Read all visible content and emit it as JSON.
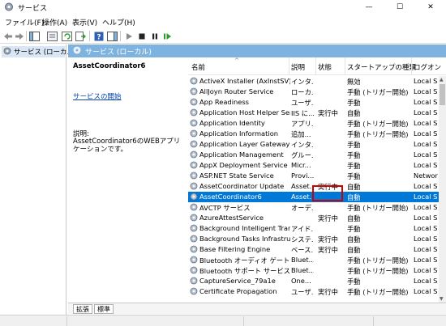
{
  "window": {
    "title": "サービス",
    "minimize_glyph": "—",
    "maximize_glyph": "☐",
    "close_glyph": "✕"
  },
  "menu": {
    "items": [
      "ファイル(F)",
      "操作(A)",
      "表示(V)",
      "ヘルプ(H)"
    ]
  },
  "toolbar": {
    "icons": [
      "back-icon",
      "forward-icon",
      "show-console-tree-icon",
      "properties-icon",
      "refresh-icon",
      "export-list-icon",
      "help-icon",
      "show-action-pane-icon",
      "play-icon",
      "stop-icon",
      "pause-icon",
      "restart-icon"
    ]
  },
  "tree": {
    "root_label": "サービス (ローカル)"
  },
  "pane": {
    "header": "サービス (ローカル)"
  },
  "detail": {
    "service_name": "AssetCoordinator6",
    "start_link": "サービスの開始",
    "description_label": "説明:",
    "description_text": "AssetCoordinator6のWEBアプリケーションです。"
  },
  "list": {
    "columns": {
      "name": "名前",
      "description": "説明",
      "status": "状態",
      "startup": "スタートアップの種類",
      "logon": "ログオン"
    },
    "rows": [
      {
        "name": "ActiveX Installer (AxInstSV)",
        "description": "インタ...",
        "status": "",
        "startup": "無効",
        "logon": "Local S"
      },
      {
        "name": "AllJoyn Router Service",
        "description": "ローカ...",
        "status": "",
        "startup": "手動 (トリガー開始)",
        "logon": "Local S"
      },
      {
        "name": "App Readiness",
        "description": "ユーザ...",
        "status": "",
        "startup": "手動",
        "logon": "Local S"
      },
      {
        "name": "Application Host Helper Ser...",
        "description": "IIS に...",
        "status": "実行中",
        "startup": "自動",
        "logon": "Local S"
      },
      {
        "name": "Application Identity",
        "description": "アプリ...",
        "status": "",
        "startup": "手動 (トリガー開始)",
        "logon": "Local S"
      },
      {
        "name": "Application Information",
        "description": "追加...",
        "status": "",
        "startup": "手動 (トリガー開始)",
        "logon": "Local S"
      },
      {
        "name": "Application Layer Gateway ...",
        "description": "インタ...",
        "status": "",
        "startup": "手動",
        "logon": "Local S"
      },
      {
        "name": "Application Management",
        "description": "グルー...",
        "status": "",
        "startup": "手動",
        "logon": "Local S"
      },
      {
        "name": "AppX Deployment Service (...",
        "description": "Micr...",
        "status": "",
        "startup": "手動",
        "logon": "Local S"
      },
      {
        "name": "ASP.NET State Service",
        "description": "Provi...",
        "status": "",
        "startup": "手動",
        "logon": "Networ"
      },
      {
        "name": "AssetCoordinator Update",
        "description": "Asset...",
        "status": "実行中",
        "startup": "自動",
        "logon": "Local S"
      },
      {
        "name": "AssetCoordinator6",
        "description": "Asset...",
        "status": "",
        "startup": "自動",
        "logon": "Local S"
      },
      {
        "name": "AVCTP サービス",
        "description": "オーデ...",
        "status": "",
        "startup": "手動 (トリガー開始)",
        "logon": "Local S"
      },
      {
        "name": "AzureAttestService",
        "description": "",
        "status": "実行中",
        "startup": "自動",
        "logon": "Local S"
      },
      {
        "name": "Background Intelligent Tran...",
        "description": "アイド...",
        "status": "",
        "startup": "手動",
        "logon": "Local S"
      },
      {
        "name": "Background Tasks Infrastruc...",
        "description": "システ...",
        "status": "実行中",
        "startup": "自動",
        "logon": "Local S"
      },
      {
        "name": "Base Filtering Engine",
        "description": "ベース...",
        "status": "実行中",
        "startup": "自動",
        "logon": "Local S"
      },
      {
        "name": "Bluetooth オーディオ ゲートウェ...",
        "description": "Bluet...",
        "status": "",
        "startup": "手動 (トリガー開始)",
        "logon": "Local S"
      },
      {
        "name": "Bluetooth サポート サービス",
        "description": "Bluet...",
        "status": "",
        "startup": "手動 (トリガー開始)",
        "logon": "Local S"
      },
      {
        "name": "CaptureService_79a1e",
        "description": "One...",
        "status": "",
        "startup": "手動",
        "logon": "Local S"
      },
      {
        "name": "Certificate Propagation",
        "description": "ユーザ...",
        "status": "実行中",
        "startup": "手動 (トリガー開始)",
        "logon": "Local S"
      }
    ]
  },
  "tabs": {
    "extended": "拡張",
    "standard": "標準"
  },
  "colors": {
    "selection": "#0078d7",
    "pane_header": "#7eb3e0",
    "highlight": "#cc0000",
    "link": "#0645ad"
  }
}
